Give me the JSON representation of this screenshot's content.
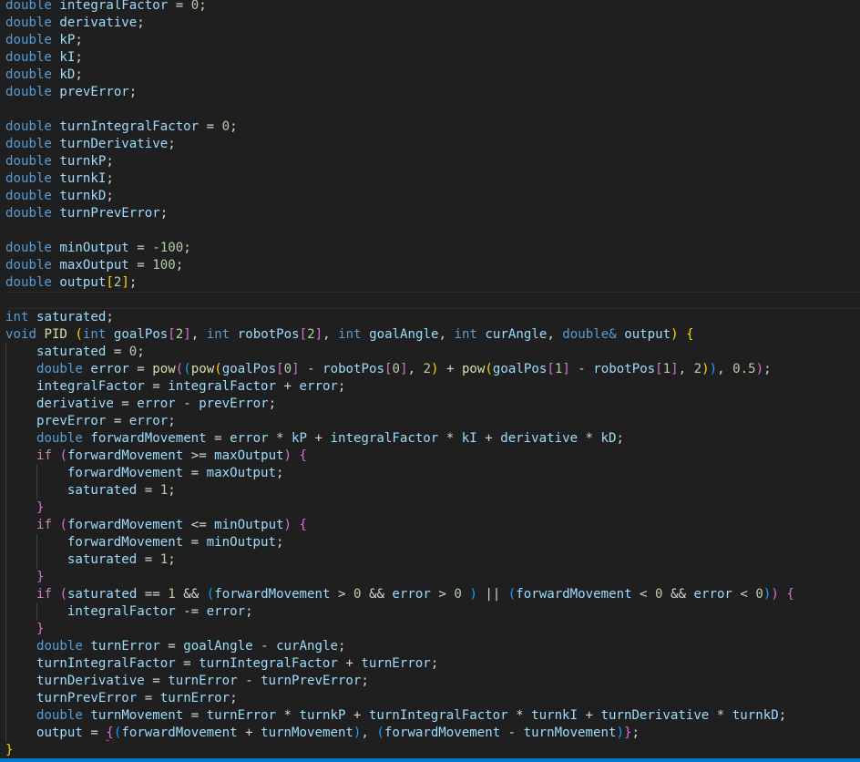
{
  "lines": [
    [
      "kw:double",
      " ",
      "var:integralFactor",
      " = ",
      "num:0",
      ";"
    ],
    [
      "kw:double",
      " ",
      "var:derivative",
      ";"
    ],
    [
      "kw:double",
      " ",
      "var:kP",
      ";"
    ],
    [
      "kw:double",
      " ",
      "var:kI",
      ";"
    ],
    [
      "kw:double",
      " ",
      "var:kD",
      ";"
    ],
    [
      "kw:double",
      " ",
      "var:prevError",
      ";"
    ],
    [],
    [
      "kw:double",
      " ",
      "var:turnIntegralFactor",
      " = ",
      "num:0",
      ";"
    ],
    [
      "kw:double",
      " ",
      "var:turnDerivative",
      ";"
    ],
    [
      "kw:double",
      " ",
      "var:turnkP",
      ";"
    ],
    [
      "kw:double",
      " ",
      "var:turnkI",
      ";"
    ],
    [
      "kw:double",
      " ",
      "var:turnkD",
      ";"
    ],
    [
      "kw:double",
      " ",
      "var:turnPrevError",
      ";"
    ],
    [],
    [
      "kw:double",
      " ",
      "var:minOutput",
      " = ",
      "num:-100",
      ";"
    ],
    [
      "kw:double",
      " ",
      "var:maxOutput",
      " = ",
      "num:100",
      ";"
    ],
    [
      "kw:double",
      " ",
      "var:output",
      "b1:[",
      "num:2",
      "b1:]",
      ";"
    ],
    [],
    [
      "kw:int",
      " ",
      "var:saturated",
      ";"
    ],
    [
      "kw:void",
      " ",
      "fn:PID",
      " ",
      "b1:(",
      "kw:int",
      " ",
      "var:goalPos",
      "b2:[",
      "num:2",
      "b2:]",
      ", ",
      "kw:int",
      " ",
      "var:robotPos",
      "b2:[",
      "num:2",
      "b2:]",
      ", ",
      "kw:int",
      " ",
      "var:goalAngle",
      ", ",
      "kw:int",
      " ",
      "var:curAngle",
      ", ",
      "kw:double&",
      " ",
      "var:output",
      "b1:)",
      " ",
      "b1:{"
    ],
    [
      "    ",
      "var:saturated",
      " = ",
      "num:0",
      ";"
    ],
    [
      "    ",
      "kw:double",
      " ",
      "var:error",
      " = ",
      "fn:pow",
      "b2:(",
      "b3:(",
      "fn:pow",
      "b1:(",
      "var:goalPos",
      "b2:[",
      "num:0",
      "b2:]",
      " - ",
      "var:robotPos",
      "b2:[",
      "num:0",
      "b2:]",
      ", ",
      "num:2",
      "b1:)",
      " + ",
      "fn:pow",
      "b1:(",
      "var:goalPos",
      "b2:[",
      "num:1",
      "b2:]",
      " - ",
      "var:robotPos",
      "b2:[",
      "num:1",
      "b2:]",
      ", ",
      "num:2",
      "b1:)",
      "b3:)",
      ", ",
      "num:0.5",
      "b2:)",
      ";"
    ],
    [
      "    ",
      "var:integralFactor",
      " = ",
      "var:integralFactor",
      " + ",
      "var:error",
      ";"
    ],
    [
      "    ",
      "var:derivative",
      " = ",
      "var:error",
      " - ",
      "var:prevError",
      ";"
    ],
    [
      "    ",
      "var:prevError",
      " = ",
      "var:error",
      ";"
    ],
    [
      "    ",
      "kw:double",
      " ",
      "var:forwardMovement",
      " = ",
      "var:error",
      " * ",
      "var:kP",
      " + ",
      "var:integralFactor",
      " * ",
      "var:kI",
      " + ",
      "var:derivative",
      " * ",
      "var:kD",
      ";"
    ],
    [
      "    ",
      "ctl:if",
      " ",
      "b2:(",
      "var:forwardMovement",
      " >= ",
      "var:maxOutput",
      "b2:)",
      " ",
      "b2:{"
    ],
    [
      "        ",
      "var:forwardMovement",
      " = ",
      "var:maxOutput",
      ";"
    ],
    [
      "        ",
      "var:saturated",
      " = ",
      "num:1",
      ";"
    ],
    [
      "    ",
      "b2:}"
    ],
    [
      "    ",
      "ctl:if",
      " ",
      "b2:(",
      "var:forwardMovement",
      " <= ",
      "var:minOutput",
      "b2:)",
      " ",
      "b2:{"
    ],
    [
      "        ",
      "var:forwardMovement",
      " = ",
      "var:minOutput",
      ";"
    ],
    [
      "        ",
      "var:saturated",
      " = ",
      "num:1",
      ";"
    ],
    [
      "    ",
      "b2:}"
    ],
    [
      "    ",
      "ctl:if",
      " ",
      "b2:(",
      "var:saturated",
      " == ",
      "num:1",
      " && ",
      "b3:(",
      "var:forwardMovement",
      " > ",
      "num:0",
      " && ",
      "var:error",
      " > ",
      "num:0",
      " ",
      "b3:)",
      " || ",
      "b3:(",
      "var:forwardMovement",
      " < ",
      "num:0",
      " && ",
      "var:error",
      " < ",
      "num:0",
      "b3:)",
      "b2:)",
      " ",
      "b2:{"
    ],
    [
      "        ",
      "var:integralFactor",
      " -= ",
      "var:error",
      ";"
    ],
    [
      "    ",
      "b2:}"
    ],
    [
      "    ",
      "kw:double",
      " ",
      "var:turnError",
      " = ",
      "var:goalAngle",
      " - ",
      "var:curAngle",
      ";"
    ],
    [
      "    ",
      "var:turnIntegralFactor",
      " = ",
      "var:turnIntegralFactor",
      " + ",
      "var:turnError",
      ";"
    ],
    [
      "    ",
      "var:turnDerivative",
      " = ",
      "var:turnError",
      " - ",
      "var:turnPrevError",
      ";"
    ],
    [
      "    ",
      "var:turnPrevError",
      " = ",
      "var:turnError",
      ";"
    ],
    [
      "    ",
      "kw:double",
      " ",
      "var:turnMovement",
      " = ",
      "var:turnError",
      " * ",
      "var:turnkP",
      " + ",
      "var:turnIntegralFactor",
      " * ",
      "var:turnkI",
      " + ",
      "var:turnDerivative",
      " * ",
      "var:turnkD",
      ";"
    ],
    [
      "    ",
      "var:output",
      " = ",
      "sq:{",
      "b3:(",
      "var:forwardMovement",
      " + ",
      "var:turnMovement",
      "b3:)",
      ", ",
      "b3:(",
      "var:forwardMovement",
      " - ",
      "var:turnMovement",
      "b3:)",
      "b2:}",
      ";"
    ],
    [
      "b1:}"
    ]
  ],
  "current_line": 17,
  "indent_guides": {
    "level1": {
      "from": 20,
      "to": 42
    },
    "level2": [
      [
        27,
        28
      ],
      [
        31,
        32
      ],
      [
        35,
        35
      ]
    ]
  },
  "colors": {
    "background": "#1f1f1f",
    "keyword": "#569cd6",
    "control": "#c586c0",
    "function": "#dcdcaa",
    "variable": "#9cdcfe",
    "number": "#b5cea8",
    "bracket1": "#ffd700",
    "bracket2": "#da70d6",
    "bracket3": "#179fff",
    "statusbar": "#007acc"
  }
}
